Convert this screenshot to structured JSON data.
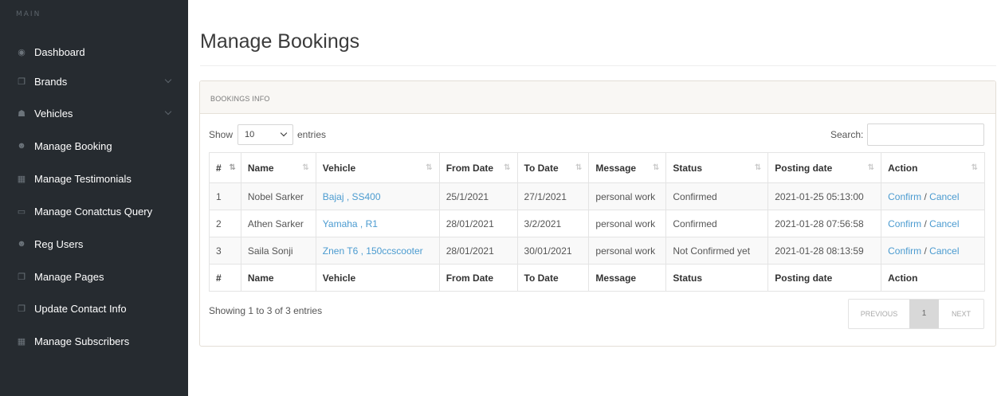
{
  "sidebar": {
    "heading": "MAIN",
    "items": [
      {
        "label": "Dashboard",
        "icon": "dashboard-icon",
        "glyph": "◉",
        "chevron": false
      },
      {
        "label": "Brands",
        "icon": "files-icon",
        "glyph": "❐",
        "chevron": true
      },
      {
        "label": "Vehicles",
        "icon": "sitemap-icon",
        "glyph": "☗",
        "chevron": true
      },
      {
        "label": "Manage Booking",
        "icon": "users-icon",
        "glyph": "☻",
        "chevron": false
      },
      {
        "label": "Manage Testimonials",
        "icon": "table-icon",
        "glyph": "▦",
        "chevron": false
      },
      {
        "label": "Manage Conatctus Query",
        "icon": "desktop-icon",
        "glyph": "▭",
        "chevron": false
      },
      {
        "label": "Reg Users",
        "icon": "users-icon",
        "glyph": "☻",
        "chevron": false
      },
      {
        "label": "Manage Pages",
        "icon": "files-icon",
        "glyph": "❐",
        "chevron": false
      },
      {
        "label": "Update Contact Info",
        "icon": "files-icon",
        "glyph": "❐",
        "chevron": false
      },
      {
        "label": "Manage Subscribers",
        "icon": "table-icon",
        "glyph": "▦",
        "chevron": false
      }
    ]
  },
  "page": {
    "title": "Manage Bookings"
  },
  "panel": {
    "heading": "BOOKINGS INFO"
  },
  "controls": {
    "show_label": "Show",
    "length_value": "10",
    "entries_label": "entries",
    "search_label": "Search:",
    "search_value": ""
  },
  "table": {
    "columns": [
      "#",
      "Name",
      "Vehicle",
      "From Date",
      "To Date",
      "Message",
      "Status",
      "Posting date",
      "Action"
    ],
    "rows": [
      {
        "num": "1",
        "name": "Nobel Sarker",
        "vehicle": "Bajaj , SS400",
        "from": "25/1/2021",
        "to": "27/1/2021",
        "message": "personal work",
        "status": "Confirmed",
        "posting": "2021-01-25 05:13:00",
        "confirm": "Confirm",
        "sep": " / ",
        "cancel": "Cancel"
      },
      {
        "num": "2",
        "name": "Athen Sarker",
        "vehicle": "Yamaha , R1",
        "from": "28/01/2021",
        "to": "3/2/2021",
        "message": "personal work",
        "status": "Confirmed",
        "posting": "2021-01-28 07:56:58",
        "confirm": "Confirm",
        "sep": " / ",
        "cancel": "Cancel"
      },
      {
        "num": "3",
        "name": "Saila Sonji",
        "vehicle": "Znen T6 , 150ccscooter",
        "from": "28/01/2021",
        "to": "30/01/2021",
        "message": "personal work",
        "status": "Not Confirmed yet",
        "posting": "2021-01-28 08:13:59",
        "confirm": "Confirm",
        "sep": " / ",
        "cancel": "Cancel"
      }
    ]
  },
  "footer": {
    "info": "Showing 1 to 3 of 3 entries",
    "prev_label": "PREVIOUS",
    "page_number": "1",
    "next_label": "NEXT"
  },
  "colors": {
    "sidebar_bg": "#262b30",
    "link": "#4b9bd0",
    "active_page": "#d8d8d8"
  }
}
